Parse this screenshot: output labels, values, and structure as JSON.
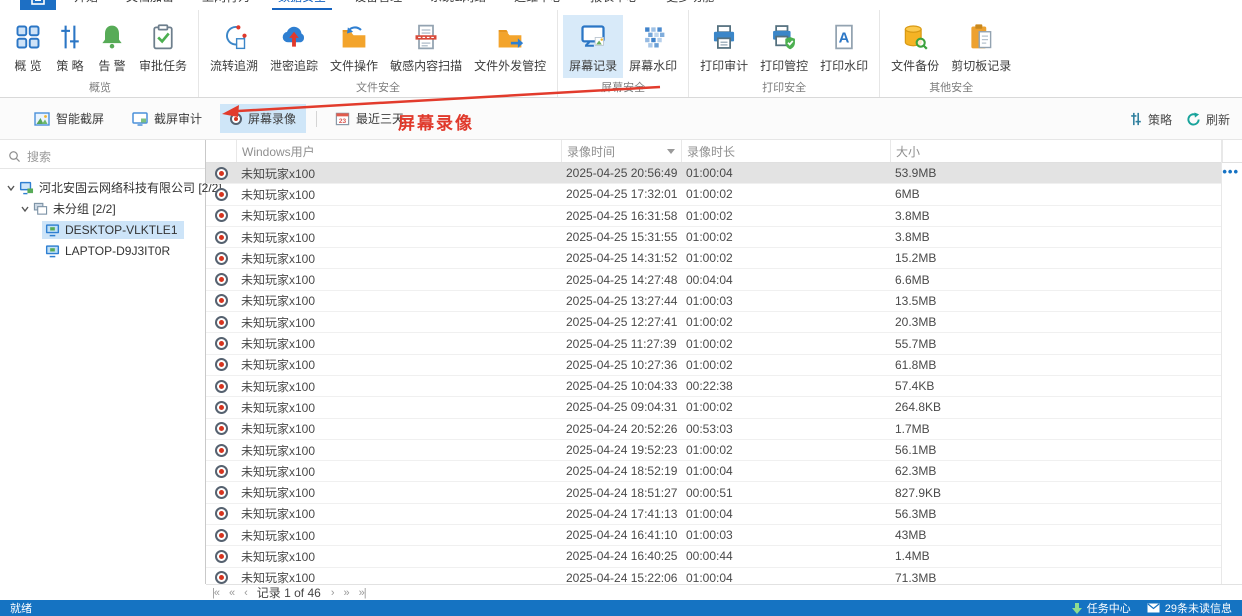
{
  "tabs": [
    {
      "label": "开始"
    },
    {
      "label": "文档加密"
    },
    {
      "label": "上网行为"
    },
    {
      "label": "数据安全",
      "active": true
    },
    {
      "label": "设备管理"
    },
    {
      "label": "系统&网络"
    },
    {
      "label": "运维中心"
    },
    {
      "label": "报表中心"
    },
    {
      "label": "更多功能"
    }
  ],
  "ribbon": {
    "groups": [
      {
        "label": "概览",
        "buttons": [
          {
            "label": "概 览"
          },
          {
            "label": "策 略"
          },
          {
            "label": "告 警"
          },
          {
            "label": "审批任务"
          }
        ]
      },
      {
        "label": "文件安全",
        "buttons": [
          {
            "label": "流转追溯"
          },
          {
            "label": "泄密追踪"
          },
          {
            "label": "文件操作"
          },
          {
            "label": "敏感内容扫描"
          },
          {
            "label": "文件外发管控"
          }
        ]
      },
      {
        "label": "屏幕安全",
        "buttons": [
          {
            "label": "屏幕记录",
            "selected": true
          },
          {
            "label": "屏幕水印"
          }
        ]
      },
      {
        "label": "打印安全",
        "buttons": [
          {
            "label": "打印审计"
          },
          {
            "label": "打印管控"
          },
          {
            "label": "打印水印"
          }
        ]
      },
      {
        "label": "其他安全",
        "buttons": [
          {
            "label": "文件备份"
          },
          {
            "label": "剪切板记录"
          }
        ]
      }
    ]
  },
  "toolbar": {
    "buttons": [
      {
        "label": "智能截屏"
      },
      {
        "label": "截屏审计"
      },
      {
        "label": "屏幕录像",
        "selected": true
      },
      {
        "label": "最近三天"
      }
    ],
    "annotation": "屏幕录像",
    "policy_label": "策略",
    "refresh_label": "刷新",
    "calendar_day": "23"
  },
  "sidebar": {
    "search_placeholder": "搜索",
    "items": [
      {
        "label": "河北安固云网络科技有限公司  [2/2]"
      },
      {
        "label": "未分组  [2/2]"
      },
      {
        "label": "DESKTOP-VLKTLE1",
        "selected": true
      },
      {
        "label": "LAPTOP-D9J3IT0R"
      }
    ]
  },
  "table": {
    "columns": [
      "Windows用户",
      "录像时间",
      "录像时长",
      "大小"
    ],
    "rows": [
      {
        "user": "未知玩家x100",
        "time": "2025-04-25 20:56:49",
        "duration": "01:00:04",
        "size": "53.9MB",
        "selected": true
      },
      {
        "user": "未知玩家x100",
        "time": "2025-04-25 17:32:01",
        "duration": "01:00:02",
        "size": "6MB"
      },
      {
        "user": "未知玩家x100",
        "time": "2025-04-25 16:31:58",
        "duration": "01:00:02",
        "size": "3.8MB"
      },
      {
        "user": "未知玩家x100",
        "time": "2025-04-25 15:31:55",
        "duration": "01:00:02",
        "size": "3.8MB"
      },
      {
        "user": "未知玩家x100",
        "time": "2025-04-25 14:31:52",
        "duration": "01:00:02",
        "size": "15.2MB"
      },
      {
        "user": "未知玩家x100",
        "time": "2025-04-25 14:27:48",
        "duration": "00:04:04",
        "size": "6.6MB"
      },
      {
        "user": "未知玩家x100",
        "time": "2025-04-25 13:27:44",
        "duration": "01:00:03",
        "size": "13.5MB"
      },
      {
        "user": "未知玩家x100",
        "time": "2025-04-25 12:27:41",
        "duration": "01:00:02",
        "size": "20.3MB"
      },
      {
        "user": "未知玩家x100",
        "time": "2025-04-25 11:27:39",
        "duration": "01:00:02",
        "size": "55.7MB"
      },
      {
        "user": "未知玩家x100",
        "time": "2025-04-25 10:27:36",
        "duration": "01:00:02",
        "size": "61.8MB"
      },
      {
        "user": "未知玩家x100",
        "time": "2025-04-25 10:04:33",
        "duration": "00:22:38",
        "size": "57.4KB"
      },
      {
        "user": "未知玩家x100",
        "time": "2025-04-25 09:04:31",
        "duration": "01:00:02",
        "size": "264.8KB"
      },
      {
        "user": "未知玩家x100",
        "time": "2025-04-24 20:52:26",
        "duration": "00:53:03",
        "size": "1.7MB"
      },
      {
        "user": "未知玩家x100",
        "time": "2025-04-24 19:52:23",
        "duration": "01:00:02",
        "size": "56.1MB"
      },
      {
        "user": "未知玩家x100",
        "time": "2025-04-24 18:52:19",
        "duration": "01:00:04",
        "size": "62.3MB"
      },
      {
        "user": "未知玩家x100",
        "time": "2025-04-24 18:51:27",
        "duration": "00:00:51",
        "size": "827.9KB"
      },
      {
        "user": "未知玩家x100",
        "time": "2025-04-24 17:41:13",
        "duration": "01:00:04",
        "size": "56.3MB"
      },
      {
        "user": "未知玩家x100",
        "time": "2025-04-24 16:41:10",
        "duration": "01:00:03",
        "size": "43MB"
      },
      {
        "user": "未知玩家x100",
        "time": "2025-04-24 16:40:25",
        "duration": "00:00:44",
        "size": "1.4MB"
      },
      {
        "user": "未知玩家x100",
        "time": "2025-04-24 15:22:06",
        "duration": "01:00:04",
        "size": "71.3MB"
      }
    ]
  },
  "pager": {
    "label": "记录 1 of 46"
  },
  "statusbar": {
    "ready": "就绪",
    "task_center": "任务中心",
    "unread": "29条未读信息"
  }
}
